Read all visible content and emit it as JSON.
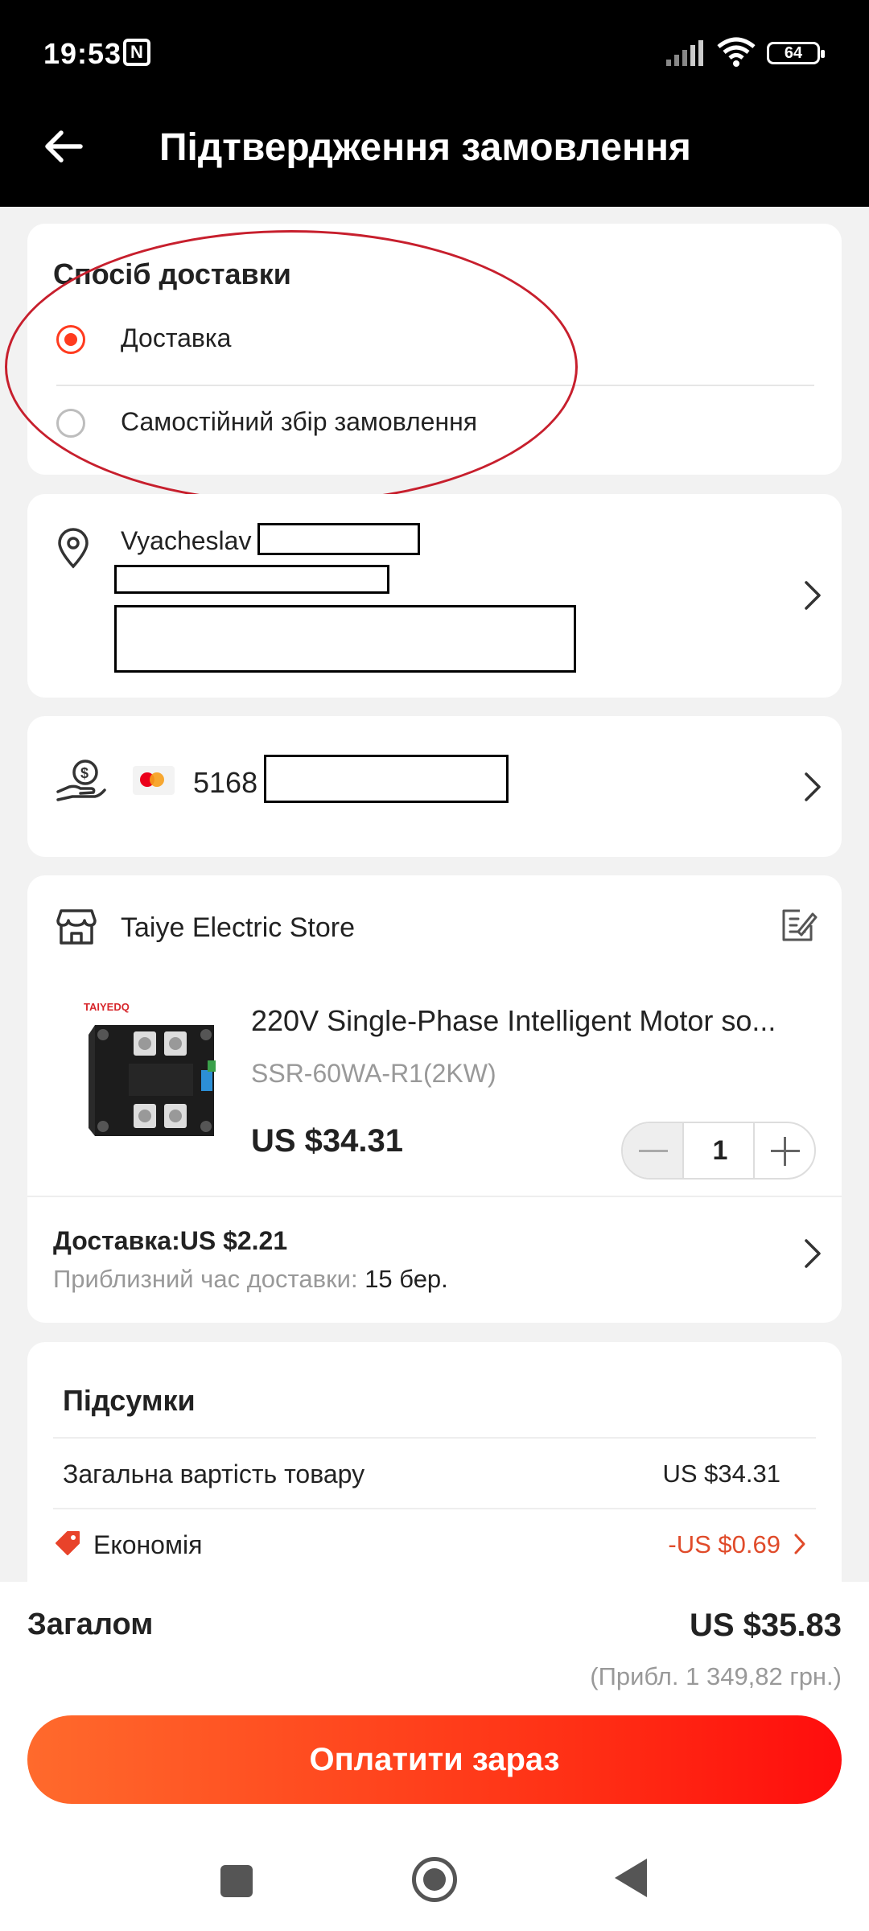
{
  "status_bar": {
    "time": "19:53",
    "nfc_icon": "nfc-icon",
    "battery": "64"
  },
  "header": {
    "title": "Підтвердження замовлення",
    "back_icon": "back-arrow-icon"
  },
  "delivery_method": {
    "title": "Спосіб доставки",
    "options": [
      {
        "label": "Доставка",
        "selected": true
      },
      {
        "label": "Самостійний збір замовлення",
        "selected": false
      }
    ]
  },
  "address": {
    "name": "Vyacheslav"
  },
  "payment": {
    "card_number": "5168"
  },
  "store": {
    "name": "Taiye Electric Store"
  },
  "product": {
    "image_brand": "TAIYEDQ",
    "title": "220V Single-Phase Intelligent Motor so...",
    "variant": "SSR-60WA-R1(2KW)",
    "price": "US $34.31",
    "quantity": "1"
  },
  "shipping": {
    "label": "Доставка:US $2.21",
    "eta_label": "Приблизний час доставки: ",
    "eta_value": "15 бер."
  },
  "summary": {
    "title": "Підсумки",
    "rows": [
      {
        "label": "Загальна вартість товару",
        "value": "US $34.31"
      },
      {
        "label": "Економія",
        "value": "-US $0.69"
      }
    ]
  },
  "total": {
    "label": "Загалом",
    "value": "US $35.83",
    "approx": "(Прибл. 1 349,82 грн.)"
  },
  "pay_button": {
    "label": "Оплатити зараз"
  },
  "colors": {
    "accent": "#ff3b1f",
    "savings": "#e04b2a",
    "header_bg": "#000000"
  }
}
